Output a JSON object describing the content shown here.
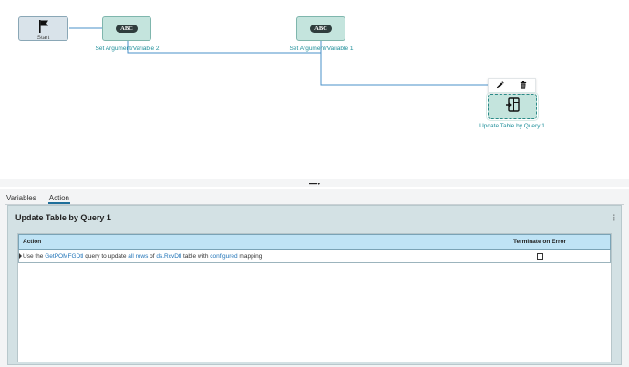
{
  "canvas": {
    "nodes": {
      "start": {
        "label": "Start",
        "icon": "flag-icon"
      },
      "set_var_2": {
        "label": "Set Argument/Variable 2",
        "badge": "ABC"
      },
      "set_var_1": {
        "label": "Set Argument/Variable 1",
        "badge": "ABC"
      },
      "update_table": {
        "label": "Update Table by Query 1",
        "icon": "table-import-icon"
      }
    },
    "toolbar": {
      "edit_icon": "pencil-icon",
      "delete_icon": "trash-icon"
    },
    "connector_color": "#4a90c8"
  },
  "splitter": {
    "icon": "drag-handle-icon"
  },
  "panel": {
    "tabs": [
      {
        "label": "Variables",
        "active": false
      },
      {
        "label": "Action",
        "active": true
      }
    ],
    "title": "Update Table by Query 1",
    "menu_icon": "kebab-menu-icon",
    "grid": {
      "columns": [
        "Action",
        "Terminate on Error"
      ],
      "rows": [
        {
          "parts": {
            "p1": "Use the ",
            "query": "GetPOMFGDtl",
            "p2": " query to update ",
            "rows_link": "all rows",
            "p3": " of ",
            "table": "ds.RcvDtl",
            "p4": " table with ",
            "mapping": "configured",
            "p5": " mapping"
          },
          "terminate_on_error": false
        }
      ]
    }
  },
  "colors": {
    "header_bg": "#bfe3f5",
    "node_bg": "#c4e4dd",
    "link": "#1f73b7",
    "node_label": "#1f8f9a"
  }
}
